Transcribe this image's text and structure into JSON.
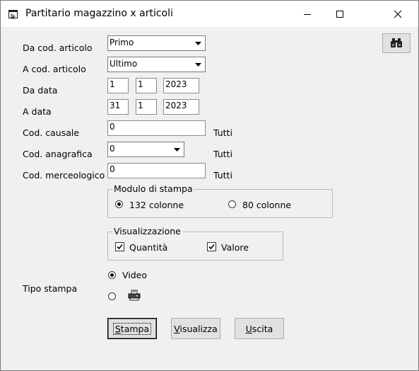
{
  "window": {
    "title": "Partitario magazzino x articoli"
  },
  "form": {
    "da_cod_articolo": {
      "label": "Da cod. articolo",
      "value": "Primo"
    },
    "a_cod_articolo": {
      "label": "A cod. articolo",
      "value": "Ultimo"
    },
    "da_data": {
      "label": "Da data",
      "day": "1",
      "month": "1",
      "year": "2023"
    },
    "a_data": {
      "label": "A data",
      "day": "31",
      "month": "1",
      "year": "2023"
    },
    "cod_causale": {
      "label": "Cod. causale",
      "value": "0",
      "hint": "Tutti"
    },
    "cod_anagrafica": {
      "label": "Cod. anagrafica",
      "value": "0",
      "hint": "Tutti"
    },
    "cod_merceologico": {
      "label": "Cod. merceologico",
      "value": "0",
      "hint": "Tutti"
    }
  },
  "modulo": {
    "title": "Modulo di stampa",
    "options": [
      {
        "label": "132 colonne",
        "selected": true
      },
      {
        "label": "80 colonne",
        "selected": false
      }
    ]
  },
  "visualizzazione": {
    "title": "Visualizzazione",
    "options": [
      {
        "label": "Quantità",
        "checked": true
      },
      {
        "label": "Valore",
        "checked": true
      }
    ]
  },
  "tipo_stampa": {
    "label": "Tipo stampa",
    "video_label": "Video",
    "video_selected": true,
    "printer_icon": "printer-icon"
  },
  "buttons": {
    "stampa": "Stampa",
    "visualizza": "Visualizza",
    "uscita": "Uscita"
  },
  "toolbar": {
    "search_icon": "binoculars-icon"
  }
}
